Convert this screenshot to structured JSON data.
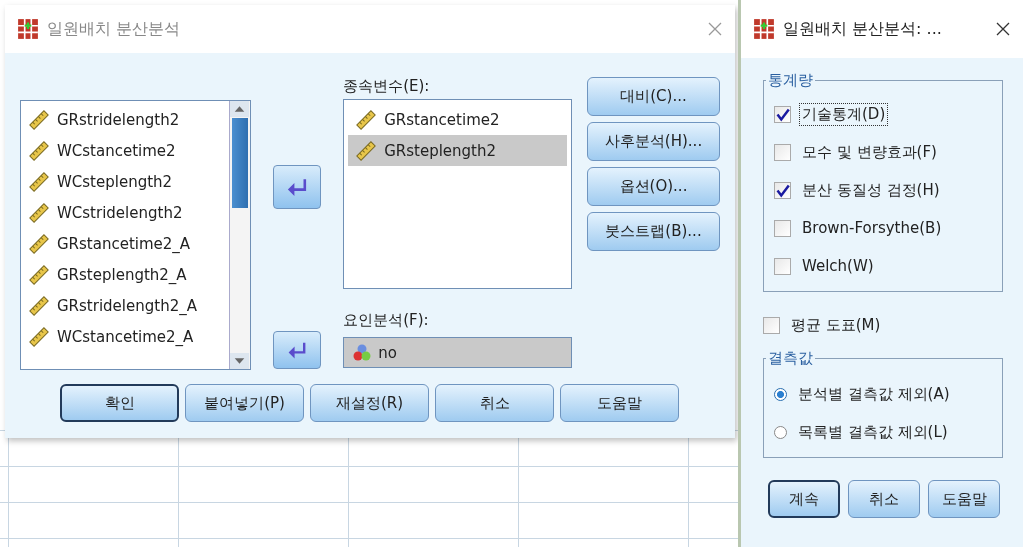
{
  "main_dialog": {
    "title": "일원배치 분산분석",
    "variables": [
      "GRstridelength2",
      "WCstancetime2",
      "WCsteplength2",
      "WCstridelength2",
      "GRstancetime2_A",
      "GRsteplength2_A",
      "GRstridelength2_A",
      "WCstancetime2_A"
    ],
    "dependent_label": "종속변수(E):",
    "dependent_list": [
      {
        "label": "GRstancetime2",
        "selected": false
      },
      {
        "label": "GRsteplength2",
        "selected": true
      }
    ],
    "factor_label": "요인분석(F):",
    "factor_value": "no",
    "side_buttons": [
      "대비(C)...",
      "사후분석(H)...",
      "옵션(O)...",
      "붓스트랩(B)..."
    ],
    "buttons": [
      {
        "label": "확인",
        "default": true
      },
      {
        "label": "붙여넣기(P)",
        "default": false
      },
      {
        "label": "재설정(R)",
        "default": false
      },
      {
        "label": "취소",
        "default": false
      },
      {
        "label": "도움말",
        "default": false
      }
    ]
  },
  "options_dialog": {
    "title": "일원배치 분산분석: ...",
    "statistics_group": "통계량",
    "statistics": [
      {
        "label": "기술통계(D)",
        "checked": true,
        "focused": true
      },
      {
        "label": "모수 및 변량효과(F)",
        "checked": false,
        "focused": false
      },
      {
        "label": "분산 동질성 검정(H)",
        "checked": true,
        "focused": false
      },
      {
        "label": "Brown-Forsythe(B)",
        "checked": false,
        "focused": false
      },
      {
        "label": "Welch(W)",
        "checked": false,
        "focused": false
      }
    ],
    "means_plot": {
      "label": "평균 도표(M)",
      "checked": false
    },
    "missing_group": "결측값",
    "missing": [
      {
        "label": "분석별 결측값 제외(A)",
        "selected": true
      },
      {
        "label": "목록별 결측값 제외(L)",
        "selected": false
      }
    ],
    "buttons": [
      {
        "label": "계속",
        "default": true
      },
      {
        "label": "취소",
        "default": false
      },
      {
        "label": "도움말",
        "default": false
      }
    ]
  }
}
